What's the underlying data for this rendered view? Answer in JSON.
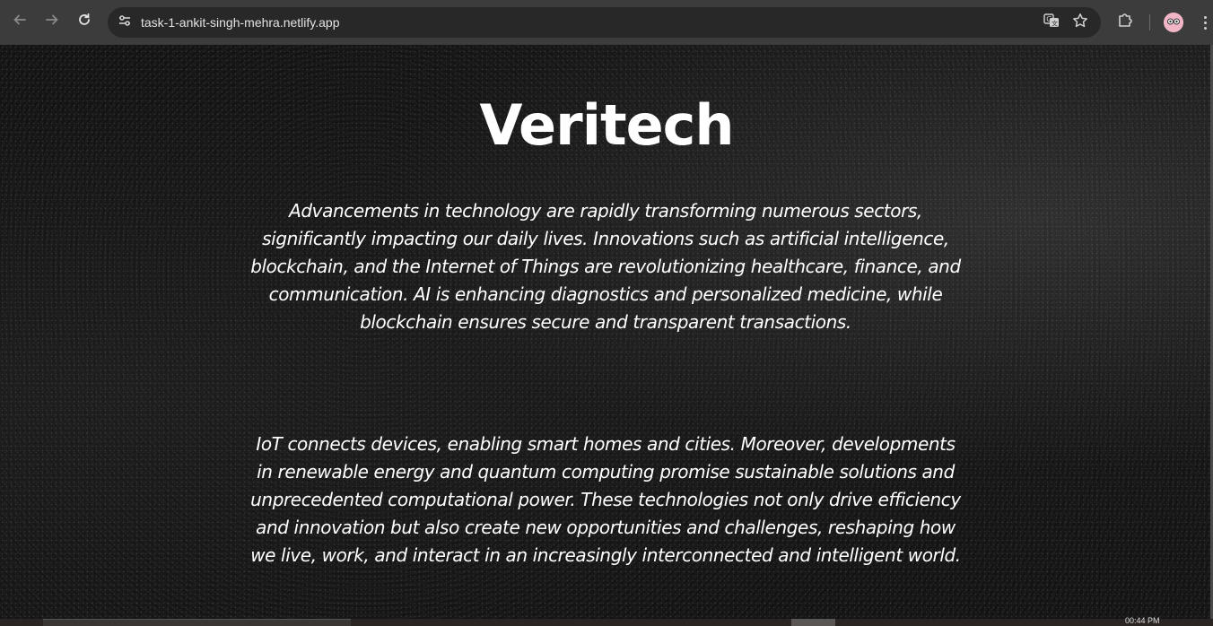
{
  "browser": {
    "url": "task-1-ankit-singh-mehra.netlify.app",
    "icons": {
      "back": "arrow-left-icon",
      "forward": "arrow-right-icon",
      "reload": "reload-icon",
      "site_info": "tune-icon",
      "translate": "translate-icon",
      "bookmark": "star-icon",
      "extensions": "puzzle-icon",
      "profile": "avatar",
      "menu": "more-vertical-icon"
    }
  },
  "page": {
    "title": "Veritech",
    "paragraph1": "Advancements in technology are rapidly transforming numerous sectors, significantly impacting our daily lives. Innovations such as artificial intelligence, blockchain, and the Internet of Things are revolutionizing healthcare, finance, and communication. AI is enhancing diagnostics and personalized medicine, while blockchain ensures secure and transparent transactions.",
    "paragraph2": "IoT connects devices, enabling smart homes and cities. Moreover, developments in renewable energy and quantum computing promise sustainable solutions and unprecedented computational power. These technologies not only drive efficiency and innovation but also create new opportunities and challenges, reshaping how we live, work, and interact in an increasingly interconnected and intelligent world."
  },
  "taskbar": {
    "clock": "00:44 PM"
  },
  "colors": {
    "toolbar": "#3c3c3c",
    "address_bar": "#282828",
    "text": "#ffffff"
  }
}
